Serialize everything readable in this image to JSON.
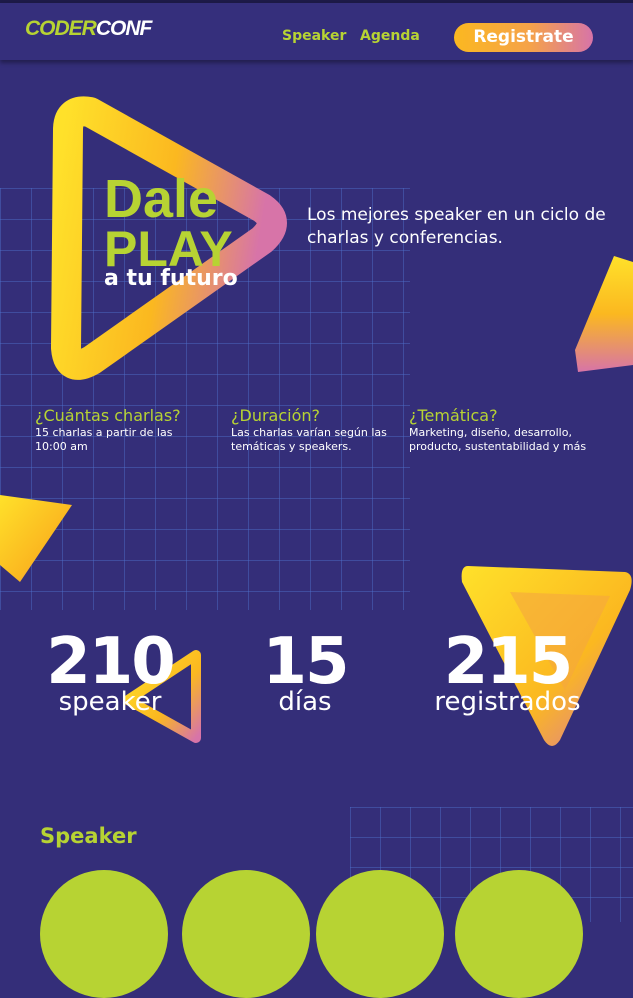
{
  "brand": {
    "logo_part1": "CODER",
    "logo_part2": "CONF"
  },
  "nav": {
    "speaker": "Speaker",
    "agenda": "Agenda",
    "register": "Registrate"
  },
  "hero": {
    "title_line1": "Dale",
    "title_line2": "PLAY",
    "subtitle": "a tu futuro",
    "tagline": "Los mejores speaker en un ciclo de charlas y conferencias."
  },
  "faq": [
    {
      "question": "¿Cuántas charlas?",
      "answer": "15 charlas a partir de las 10:00 am"
    },
    {
      "question": "¿Duración?",
      "answer": "Las charlas varían según las temáticas y speakers."
    },
    {
      "question": "¿Temática?",
      "answer": "Marketing, diseño, desarrollo, producto, sustentabilidad y más"
    }
  ],
  "stats": [
    {
      "number": "210",
      "label": "speaker"
    },
    {
      "number": "15",
      "label": "días"
    },
    {
      "number": "215",
      "label": "registrados"
    }
  ],
  "speakers_section": {
    "title": "Speaker",
    "avatar_count": 4
  },
  "colors": {
    "background": "#342e79",
    "accent": "#b7d333",
    "gradient_start": "#fbb820",
    "gradient_end": "#d774a8"
  }
}
